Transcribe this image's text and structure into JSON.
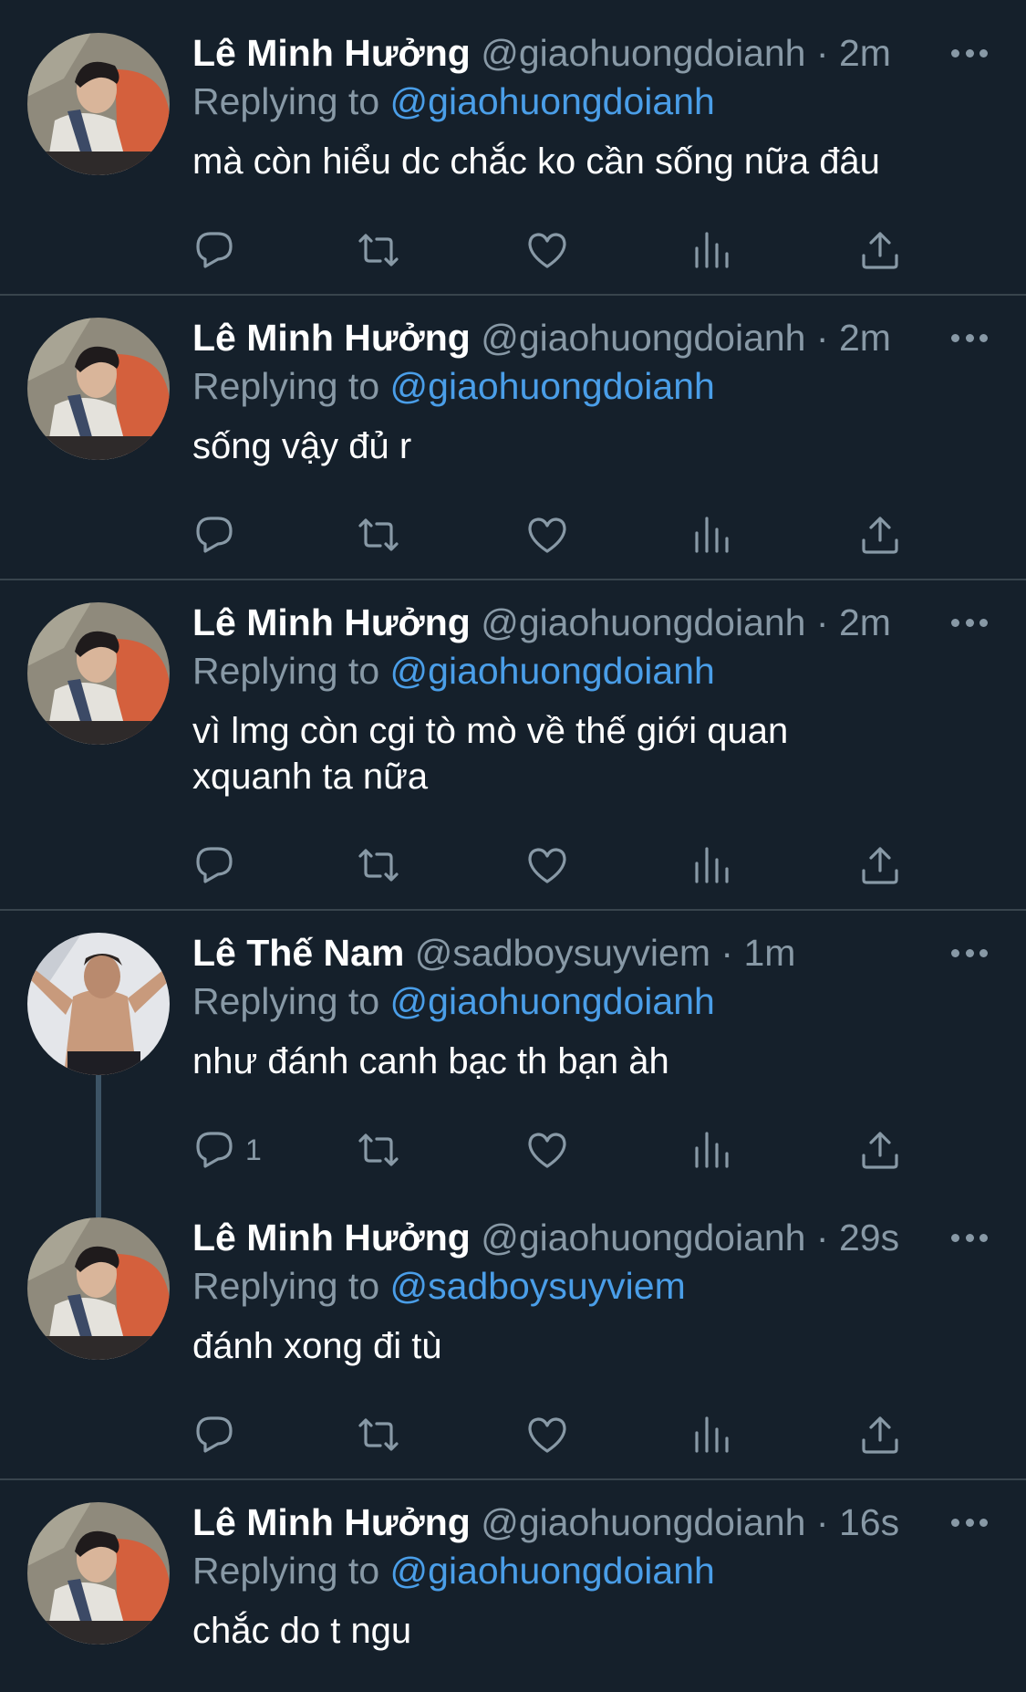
{
  "colors": {
    "background": "#15202b",
    "divider": "#38444d",
    "secondary_text": "#8899a6",
    "mention": "#4a9ee8",
    "primary_text": "#ffffff"
  },
  "tweets": [
    {
      "name": "Lê Minh Hưởng",
      "handle": "@giaohuongdoianh",
      "dot": "·",
      "time": "2m",
      "reply_prefix": "Replying to",
      "reply_to": "@giaohuongdoianh",
      "text_lines": [
        "mà còn hiểu dc chắc ko cần sống nữa đâu"
      ],
      "reply_count": "",
      "avatar": "minh-huong-avatar"
    },
    {
      "name": "Lê Minh Hưởng",
      "handle": "@giaohuongdoianh",
      "dot": "·",
      "time": "2m",
      "reply_prefix": "Replying to",
      "reply_to": "@giaohuongdoianh",
      "text_lines": [
        "sống vậy đủ r"
      ],
      "reply_count": "",
      "avatar": "minh-huong-avatar"
    },
    {
      "name": "Lê Minh Hưởng",
      "handle": "@giaohuongdoianh",
      "dot": "·",
      "time": "2m",
      "reply_prefix": "Replying to",
      "reply_to": "@giaohuongdoianh",
      "text_lines": [
        "vì lmg còn cgi tò mò về thế giới quan",
        "xquanh ta nữa"
      ],
      "reply_count": "",
      "avatar": "minh-huong-avatar"
    },
    {
      "name": "Lê Thế Nam",
      "handle": "@sadboysuyviem",
      "dot": "·",
      "time": "1m",
      "reply_prefix": "Replying to",
      "reply_to": "@giaohuongdoianh",
      "text_lines": [
        "như đánh canh bạc th bạn àh"
      ],
      "reply_count": "1",
      "avatar": "the-nam-avatar"
    },
    {
      "name": "Lê Minh Hưởng",
      "handle": "@giaohuongdoianh",
      "dot": "·",
      "time": "29s",
      "reply_prefix": "Replying to",
      "reply_to": "@sadboysuyviem",
      "text_lines": [
        "đánh xong đi tù"
      ],
      "reply_count": "",
      "avatar": "minh-huong-avatar"
    },
    {
      "name": "Lê Minh Hưởng",
      "handle": "@giaohuongdoianh",
      "dot": "·",
      "time": "16s",
      "reply_prefix": "Replying to",
      "reply_to": "@giaohuongdoianh",
      "text_lines": [
        "chắc do t ngu"
      ],
      "reply_count": "",
      "avatar": "minh-huong-avatar"
    }
  ],
  "action_icons": [
    "reply-icon",
    "retweet-icon",
    "like-icon",
    "analytics-icon",
    "share-icon"
  ]
}
